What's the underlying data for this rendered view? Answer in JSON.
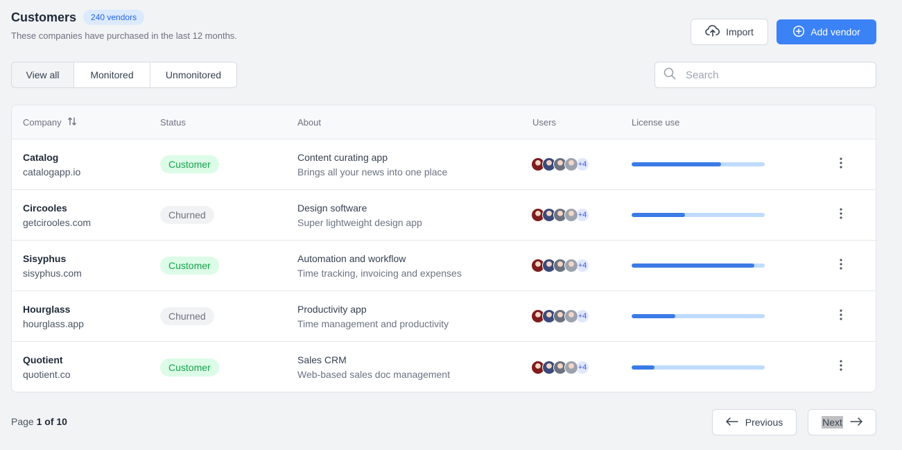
{
  "header": {
    "title": "Customers",
    "badge": "240 vendors",
    "subtitle": "These companies have purchased in the last 12 months."
  },
  "actions": {
    "import_label": "Import",
    "add_label": "Add vendor"
  },
  "tabs": [
    {
      "label": "View all",
      "active": true
    },
    {
      "label": "Monitored",
      "active": false
    },
    {
      "label": "Unmonitored",
      "active": false
    }
  ],
  "search": {
    "placeholder": "Search",
    "value": ""
  },
  "table": {
    "columns": {
      "company": "Company",
      "status": "Status",
      "about": "About",
      "users": "Users",
      "license": "License use"
    },
    "rows": [
      {
        "company": "Catalog",
        "domain": "catalogapp.io",
        "status": "Customer",
        "about_title": "Content curating app",
        "about_desc": "Brings all your news into one place",
        "users_more": "+4",
        "license_use": 0.67
      },
      {
        "company": "Circooles",
        "domain": "getcirooles.com",
        "status": "Churned",
        "about_title": "Design software",
        "about_desc": "Super lightweight design app",
        "users_more": "+4",
        "license_use": 0.4
      },
      {
        "company": "Sisyphus",
        "domain": "sisyphus.com",
        "status": "Customer",
        "about_title": "Automation and workflow",
        "about_desc": "Time tracking, invoicing and expenses",
        "users_more": "+4",
        "license_use": 0.92
      },
      {
        "company": "Hourglass",
        "domain": "hourglass.app",
        "status": "Churned",
        "about_title": "Productivity app",
        "about_desc": "Time management and productivity",
        "users_more": "+4",
        "license_use": 0.33
      },
      {
        "company": "Quotient",
        "domain": "quotient.co",
        "status": "Customer",
        "about_title": "Sales CRM",
        "about_desc": "Web-based sales doc management",
        "users_more": "+4",
        "license_use": 0.17
      }
    ]
  },
  "pagination": {
    "page_prefix": "Page",
    "page_current": "1 of 10",
    "prev_label": "Previous",
    "next_label": "Next"
  },
  "colors": {
    "accent": "#3b82f6",
    "customer_bg": "#dcfce7",
    "customer_fg": "#16a34a",
    "churned_bg": "#f1f2f4",
    "churned_fg": "#6b7280",
    "bar_fill": "#3b7be6",
    "bar_track": "#bfdbfe",
    "avatar_colors": [
      "#7f1d1d",
      "#3b4a7a",
      "#6b7280",
      "#9ca3af"
    ]
  },
  "icons": {
    "import": "cloud-upload-icon",
    "add": "plus-circle-icon",
    "search": "search-icon",
    "sort": "sort-icon",
    "row_menu": "kebab-menu-icon",
    "prev": "arrow-left-icon",
    "next": "arrow-right-icon"
  }
}
